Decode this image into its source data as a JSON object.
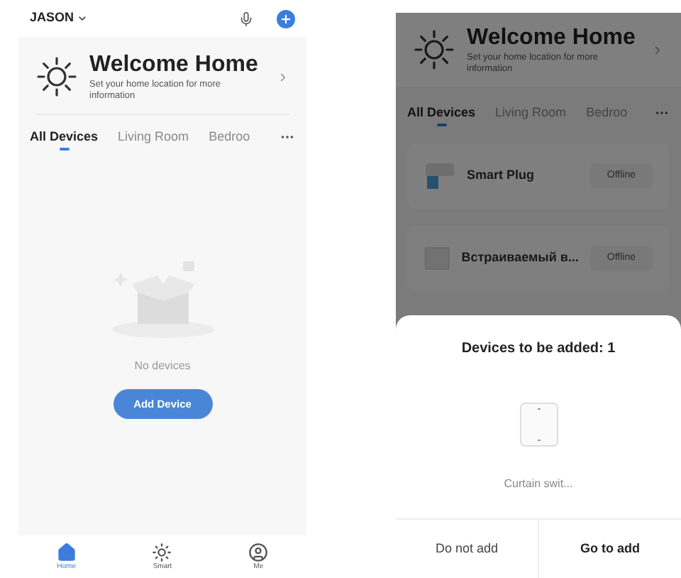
{
  "home_screen": {
    "home_name": "JASON",
    "welcome": {
      "title": "Welcome Home",
      "subtitle": "Set your home location for more information"
    },
    "tabs": [
      {
        "label": "All Devices",
        "selected": true
      },
      {
        "label": "Living Room",
        "selected": false
      },
      {
        "label": "Bedroo",
        "selected": false
      }
    ],
    "empty_state": {
      "text": "No devices",
      "button": "Add Device"
    },
    "bottom_nav": [
      {
        "label": "Home",
        "kind": "home",
        "selected": true
      },
      {
        "label": "Smart",
        "kind": "smart",
        "selected": false
      },
      {
        "label": "Me",
        "kind": "me",
        "selected": false
      }
    ]
  },
  "add_screen": {
    "welcome": {
      "title": "Welcome Home",
      "subtitle": "Set your home location for more information"
    },
    "tabs": [
      {
        "label": "All Devices",
        "selected": true
      },
      {
        "label": "Living Room",
        "selected": false
      },
      {
        "label": "Bedroo",
        "selected": false
      }
    ],
    "devices": [
      {
        "name": "Smart Plug",
        "status": "Offline",
        "kind": "plug"
      },
      {
        "name": "Встраиваемый в...",
        "status": "Offline",
        "kind": "switch"
      }
    ],
    "dialog": {
      "title": "Devices to be added: 1",
      "device": "Curtain swit...",
      "buttons": [
        {
          "label": "Do not add",
          "primary": false
        },
        {
          "label": "Go to add",
          "primary": true
        }
      ]
    }
  }
}
